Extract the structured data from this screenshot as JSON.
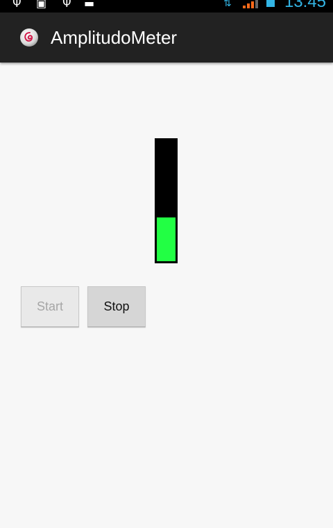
{
  "status_bar": {
    "time": "13:45",
    "icons": [
      "usb-icon",
      "sd-card-icon",
      "usb-icon",
      "photo-icon",
      "transfer-icon",
      "signal-icon",
      "battery-icon"
    ]
  },
  "action_bar": {
    "title": "AmplitudoMeter",
    "icon": "app-logo-icon"
  },
  "meter": {
    "level_fraction": 0.36,
    "fill_color": "#22ff44",
    "background_color": "#000000"
  },
  "buttons": {
    "start_label": "Start",
    "start_enabled": false,
    "stop_label": "Stop",
    "stop_enabled": true
  }
}
